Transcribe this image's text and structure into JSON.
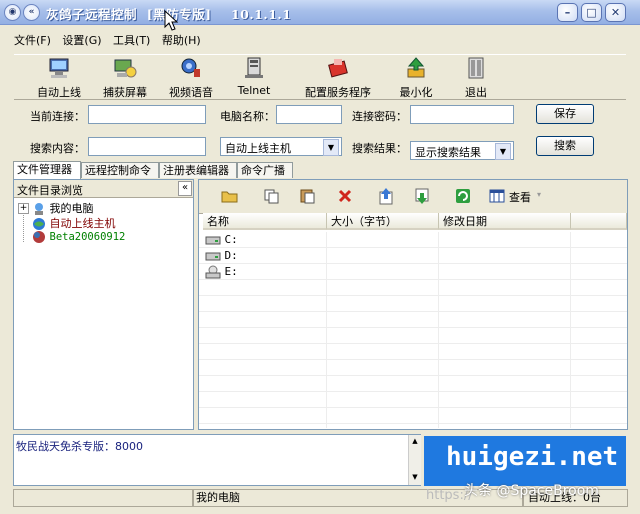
{
  "window": {
    "title": "灰鸽子远程控制  [黑防专版]    10.1.1.1"
  },
  "menu": [
    "文件(F)",
    "设置(G)",
    "工具(T)",
    "帮助(H)"
  ],
  "toolbar": [
    {
      "label": "自动上线",
      "icon": "auto-online-icon"
    },
    {
      "label": "捕获屏幕",
      "icon": "capture-screen-icon"
    },
    {
      "label": "视频语音",
      "icon": "video-voice-icon"
    },
    {
      "label": "Telnet",
      "icon": "telnet-icon"
    },
    {
      "label": "配置服务程序",
      "icon": "config-server-icon"
    },
    {
      "label": "最小化",
      "icon": "minimize-icon"
    },
    {
      "label": "退出",
      "icon": "exit-icon"
    }
  ],
  "form": {
    "current_conn_label": "当前连接：",
    "current_conn_value": "",
    "pc_name_label": "电脑名称：",
    "pc_name_value": "",
    "password_label": "连接密码：",
    "password_value": "",
    "save_label": "保存",
    "search_content_label": "搜索内容：",
    "search_content_value": "",
    "search_scope_value": "自动上线主机",
    "search_result_label": "搜索结果：",
    "search_result_value": "显示搜索结果",
    "search_label": "搜索"
  },
  "tabs": [
    "文件管理器",
    "远程控制命令",
    "注册表编辑器",
    "命令广播"
  ],
  "tree": {
    "header": "文件目录浏览",
    "collapse": "«",
    "items": [
      {
        "label": "我的电脑",
        "color": "#000000"
      },
      {
        "label": "自动上线主机",
        "color": "#800000"
      },
      {
        "label": "Beta20060912",
        "color": "#008000"
      }
    ]
  },
  "filetoolbar": {
    "view_label": "查看"
  },
  "columns": [
    "名称",
    "大小（字节）",
    "修改日期"
  ],
  "drives": [
    "C:",
    "D:",
    "E:"
  ],
  "log": {
    "text": "牧民战天免杀专版：8000"
  },
  "status": {
    "left": "",
    "center": "我的电脑",
    "right": "自动上线：0台"
  },
  "watermark": {
    "site": "huigezi.net",
    "sub": "头条 @SpaceBroom",
    "url": "https://"
  }
}
